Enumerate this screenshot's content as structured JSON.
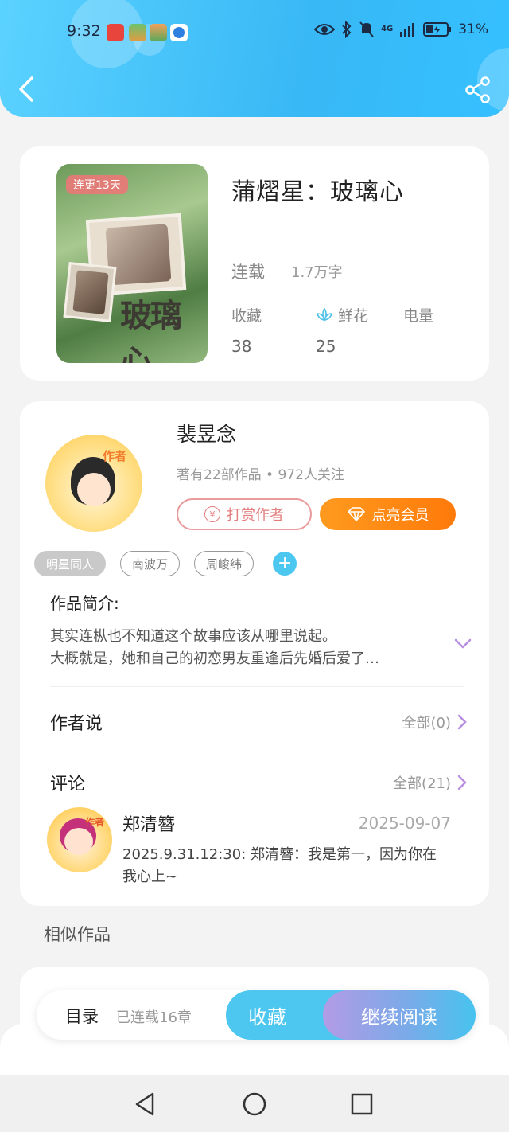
{
  "status_bar": {
    "time": "9:32",
    "network": "4G",
    "battery": "31%",
    "icons": [
      "huawei-app-icon",
      "game-app-icon",
      "game-app-icon-2",
      "browser-app-icon",
      "eye-icon",
      "bluetooth-icon",
      "mute-bell-icon",
      "signal-icon",
      "battery-icon"
    ]
  },
  "header": {
    "back_icon": "chevron-left-icon",
    "share_icon": "share-icon",
    "accent": "#38b8f5"
  },
  "book": {
    "cover_badge": "连更13天",
    "cover_art_text": "玻璃心",
    "title": "蒲熠星：玻璃心",
    "status": "连载",
    "word_count": "1.7万字",
    "stats": [
      {
        "label": "收藏",
        "value": "38"
      },
      {
        "label": "鲜花",
        "value": "25",
        "icon": "lotus-icon"
      },
      {
        "label": "电量",
        "value": ""
      }
    ]
  },
  "author": {
    "avatar_tag": "作者",
    "name": "裴昱念",
    "info": "著有22部作品 • 972人关注",
    "tip_button": "打赏作者",
    "tip_icon_glyph": "¥",
    "vip_button": "点亮会员",
    "vip_color": "#ff8a14"
  },
  "tags": [
    "明星同人",
    "南波万",
    "周峻纬"
  ],
  "add_tag_glyph": "+",
  "intro": {
    "title": "作品简介:",
    "line1": "其实连枞也不知道这个故事应该从哪里说起。",
    "line2": "大概就是，她和自己的初恋男友重逢后先婚后爱了…"
  },
  "author_says": {
    "title": "作者说",
    "link": "全部(0)"
  },
  "comments": {
    "title": "评论",
    "link": "全部(21)",
    "item": {
      "avatar_tag": "作者",
      "name": "郑清簪",
      "date": "2025-09-07",
      "text": "2025.9.31.12:30: 郑清簪：我是第一，因为你在我心上~"
    }
  },
  "similar_title": "相似作品",
  "action_bar": {
    "toc": "目录",
    "serial": "已连载16章",
    "favorite": "收藏",
    "continue": "继续阅读"
  },
  "nav_bar": [
    "back-triangle-icon",
    "home-circle-icon",
    "recents-square-icon"
  ]
}
